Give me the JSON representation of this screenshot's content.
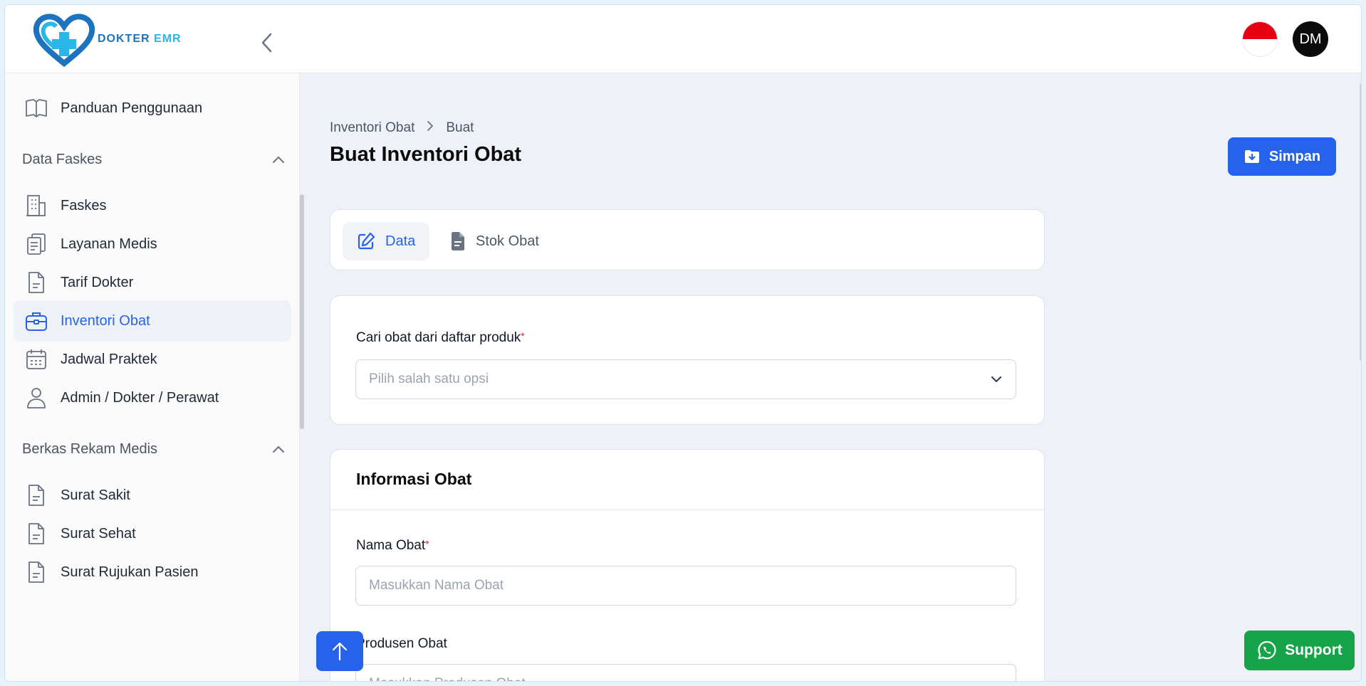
{
  "brand": {
    "text_main": "DOKTER",
    "text_accent": "EMR",
    "primary": "#2563eb",
    "logo_dark": "#1e73be",
    "logo_light": "#29b6e8"
  },
  "header": {
    "avatar_initials": "DM",
    "language_flag": "indonesia-flag"
  },
  "sidebar": {
    "top_item": {
      "label": "Panduan Penggunaan",
      "icon": "book-icon"
    },
    "groups": [
      {
        "label": "Data Faskes",
        "items": [
          {
            "label": "Faskes",
            "icon": "building-icon"
          },
          {
            "label": "Layanan Medis",
            "icon": "clipboard-icon"
          },
          {
            "label": "Tarif Dokter",
            "icon": "document-icon"
          },
          {
            "label": "Inventori Obat",
            "icon": "briefcase-icon",
            "active": true
          },
          {
            "label": "Jadwal Praktek",
            "icon": "calendar-icon"
          },
          {
            "label": "Admin / Dokter / Perawat",
            "icon": "user-icon"
          }
        ]
      },
      {
        "label": "Berkas Rekam Medis",
        "items": [
          {
            "label": "Surat Sakit",
            "icon": "document-icon"
          },
          {
            "label": "Surat Sehat",
            "icon": "document-icon"
          },
          {
            "label": "Surat Rujukan Pasien",
            "icon": "document-icon"
          }
        ]
      }
    ]
  },
  "breadcrumb": {
    "parent": "Inventori Obat",
    "current": "Buat"
  },
  "page": {
    "title": "Buat Inventori Obat",
    "save_label": "Simpan"
  },
  "tabs": [
    {
      "label": "Data",
      "icon": "edit-icon",
      "active": true
    },
    {
      "label": "Stok Obat",
      "icon": "file-icon",
      "active": false
    }
  ],
  "search_card": {
    "label": "Cari obat dari daftar produk",
    "required_mark": "*",
    "placeholder": "Pilih salah satu opsi"
  },
  "info_card": {
    "title": "Informasi Obat",
    "fields": [
      {
        "label": "Nama Obat",
        "required": "*",
        "placeholder": "Masukkan Nama Obat"
      },
      {
        "label": "Produsen Obat",
        "required": "",
        "placeholder": "Masukkan Produsen Obat"
      }
    ]
  },
  "support_label": "Support"
}
